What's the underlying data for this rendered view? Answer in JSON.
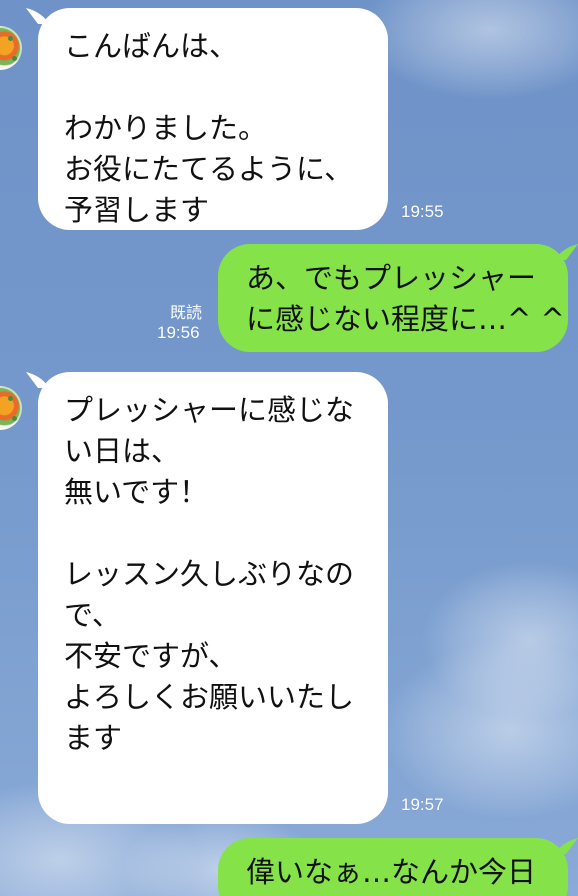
{
  "messages": [
    {
      "direction": "in",
      "text": "こんばんは、\n\nわかりました。\nお役にたてるように、\n予習します",
      "time": "19:55"
    },
    {
      "direction": "out",
      "text": "あ、でもプレッシャー\nに感じない程度に…^ ^",
      "time": "19:56",
      "read_label": "既読"
    },
    {
      "direction": "in",
      "text": "プレッシャーに感じな\nい日は、\n無いです！\n\nレッスン久しぶりなの\nで、\n不安ですが、\nよろしくお願いいたし\nます",
      "time": "19:57"
    },
    {
      "direction": "out",
      "text": "偉いなぁ…なんか今日"
    }
  ],
  "colors": {
    "background": "#7498cb",
    "incoming_bubble": "#ffffff",
    "outgoing_bubble": "#85e249",
    "timestamp": "#ffffff"
  },
  "icons": {
    "avatar": "contact-avatar-icon"
  }
}
